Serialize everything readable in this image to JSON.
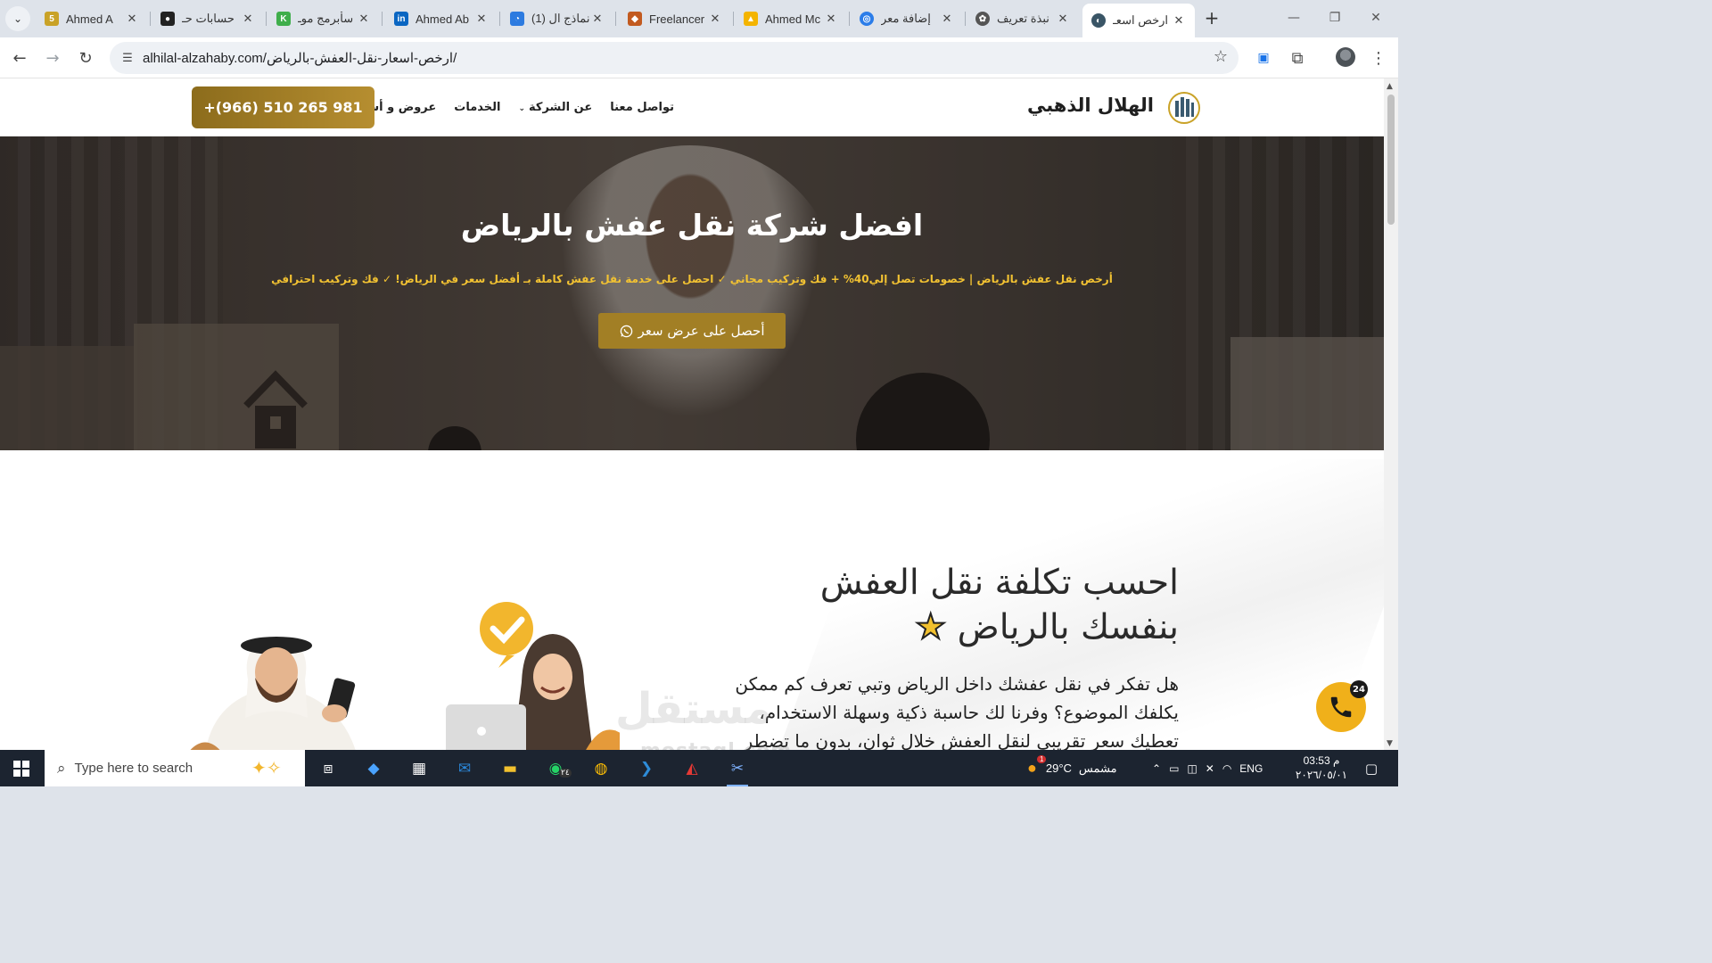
{
  "browser": {
    "tabs": [
      {
        "title": "Ahmed A",
        "favicon_color": "#c9a227",
        "favicon_text": "5"
      },
      {
        "title": "حسابات حـ",
        "favicon_color": "#222222",
        "favicon_text": "●"
      },
      {
        "title": "سأبرمج موـ",
        "favicon_color": "#3fae4b",
        "favicon_text": "K"
      },
      {
        "title": "Ahmed Ab",
        "favicon_color": "#0a66c2",
        "favicon_text": "in"
      },
      {
        "title": "(1) نماذج ال",
        "favicon_color": "#2d7be0",
        "favicon_text": "◔"
      },
      {
        "title": "Freelancer",
        "favicon_color": "#c25a1f",
        "favicon_text": "◆"
      },
      {
        "title": "Ahmed Mc",
        "favicon_color": "#f4b400",
        "favicon_text": "▲"
      },
      {
        "title": "إضافة معر",
        "favicon_color": "#2b7de9",
        "favicon_text": "◎"
      },
      {
        "title": "نبذة تعريف",
        "favicon_color": "#555555",
        "favicon_text": "✿"
      },
      {
        "title": "ارخص اسعـ",
        "favicon_color": "#3a5566",
        "favicon_text": "◐",
        "active": true
      }
    ],
    "new_tab_icon": "+",
    "window_controls": [
      "—",
      "❐",
      "✕"
    ],
    "url": "alhilal-alzahaby.com/ارخص-اسعار-نقل-العفش-بالرياض/"
  },
  "site": {
    "brand": "الهلال الذهبي",
    "nav": [
      {
        "label": "عروض و أسعار"
      },
      {
        "label": "الخدمات"
      },
      {
        "label": "عن الشركة",
        "has_caret": true
      },
      {
        "label": "تواصل معنا"
      }
    ],
    "phone": "+(966) 510 265 981",
    "colors": {
      "gold": "#a27f25",
      "accent_yellow": "#f2c232",
      "fab": "#f0b01a"
    }
  },
  "hero": {
    "title": "افضل شركة نقل عفش بالرياض",
    "subtitle": "أرخص نقل عفش بالرياض | خصومات تصل إلي40% + فك وتركيب مجاني ✓ احصل على خدمة نقل عفش كاملة بـ أفضل سعر في الرياض! ✓ فك وتركيب احترافي",
    "cta": "أحصل على عرض سعر"
  },
  "calculator": {
    "title_line1": "احسب تكلفة نقل العفش",
    "title_line2": "بنفسك بالرياض",
    "text_line1": "هل تفكر في نقل عفشك داخل الرياض وتبي تعرف كم ممكن",
    "text_line2": "يكلفك الموضوع؟ وفرنا لك حاسبة ذكية وسهلة الاستخدام،",
    "text_line3": "تعطيك سعر تقريبي لنقل العفش خلال ثوان، بدون ما تضطر"
  },
  "watermark": {
    "arabic": "مستقل",
    "latin": "mostaql.com"
  },
  "call_fab": {
    "badge": "24"
  },
  "taskbar": {
    "search_placeholder": "Type here to search",
    "weather_temp": "29°C",
    "weather_text": "مشمس",
    "weather_badge": "1",
    "language": "ENG",
    "time": "03:53 م",
    "date": "٢٠٢٦/٠٥/٠١",
    "whatsapp_badge": "٢٤"
  }
}
